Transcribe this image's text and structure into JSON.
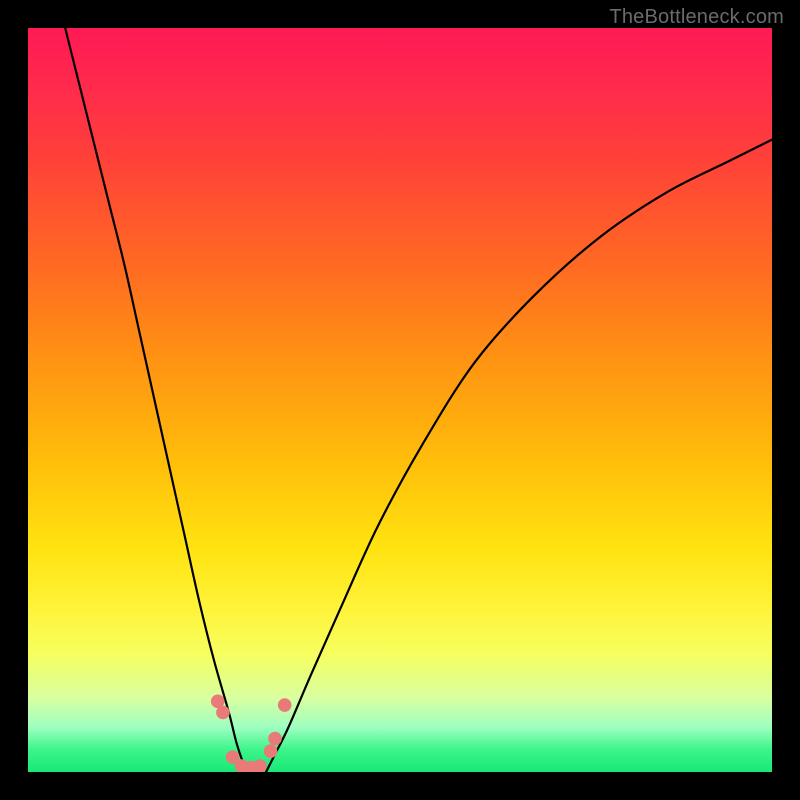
{
  "watermark": {
    "text": "TheBottleneck.com"
  },
  "colors": {
    "frame": "#000000",
    "gradient_top": "#ff1a54",
    "gradient_mid1": "#ff9412",
    "gradient_mid2": "#fff33a",
    "gradient_bottom": "#18e876",
    "curve": "#000000",
    "marker": "#e97a78"
  },
  "chart_data": {
    "type": "line",
    "title": "",
    "xlabel": "",
    "ylabel": "",
    "xlim": [
      0,
      100
    ],
    "ylim": [
      0,
      100
    ],
    "grid": false,
    "legend": false,
    "note": "No axis tick labels or numeric values are rendered in the image; series values are estimated from pixel geometry on a 0–100 normalized range for both axes.",
    "series": [
      {
        "name": "left-curve",
        "x": [
          5,
          7,
          9,
          11,
          13,
          15,
          17,
          19,
          21,
          23,
          25,
          27,
          28,
          29,
          29.5
        ],
        "y": [
          100,
          92,
          84,
          76,
          68,
          59,
          50,
          41,
          32,
          23,
          15,
          8,
          4,
          1,
          0
        ]
      },
      {
        "name": "right-curve",
        "x": [
          32,
          33,
          35,
          38,
          42,
          47,
          53,
          60,
          68,
          77,
          86,
          94,
          100
        ],
        "y": [
          0,
          2,
          6,
          13,
          22,
          33,
          44,
          55,
          64,
          72,
          78,
          82,
          85
        ]
      }
    ],
    "markers": [
      {
        "x": 25.5,
        "y": 9.5
      },
      {
        "x": 26.2,
        "y": 8.0
      },
      {
        "x": 27.5,
        "y": 2.0
      },
      {
        "x": 28.7,
        "y": 0.8
      },
      {
        "x": 30.0,
        "y": 0.6
      },
      {
        "x": 31.2,
        "y": 0.8
      },
      {
        "x": 32.6,
        "y": 2.8
      },
      {
        "x": 33.2,
        "y": 4.5
      },
      {
        "x": 34.5,
        "y": 9.0
      }
    ]
  }
}
